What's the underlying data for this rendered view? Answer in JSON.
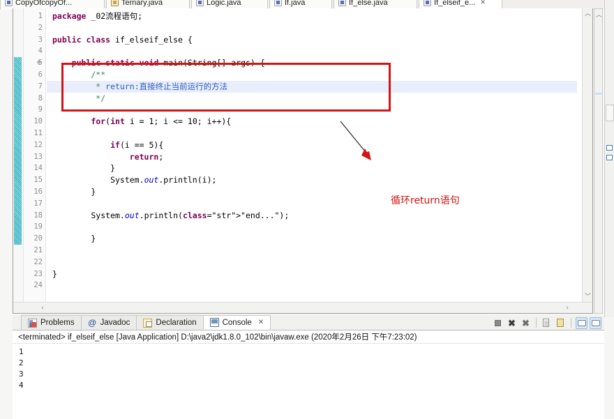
{
  "editor_tabs": [
    {
      "label": "CopyOfcopyOf...",
      "icon": "java-file-icon",
      "active": false,
      "closable": false,
      "modified": false
    },
    {
      "label": "Ternary.java",
      "icon": "java-file-modified-icon",
      "active": false,
      "closable": false,
      "modified": true
    },
    {
      "label": "Logic.java",
      "icon": "java-file-icon",
      "active": false,
      "closable": false,
      "modified": false
    },
    {
      "label": "If.java",
      "icon": "java-file-icon",
      "active": false,
      "closable": false,
      "modified": false
    },
    {
      "label": "If_else.java",
      "icon": "java-file-icon",
      "active": false,
      "closable": false,
      "modified": false
    },
    {
      "label": "If_elseif_e...",
      "icon": "java-file-icon",
      "active": true,
      "closable": true,
      "modified": false
    }
  ],
  "code": {
    "line_numbers": [
      1,
      2,
      3,
      4,
      5,
      6,
      7,
      8,
      9,
      10,
      11,
      12,
      13,
      14,
      15,
      16,
      17,
      18,
      19,
      20,
      21,
      22,
      23,
      24
    ],
    "highlighted_line": 7,
    "fold_marker_line": 5,
    "scope_bar_from": 5,
    "scope_bar_to": 20,
    "lines": [
      {
        "n": 1,
        "text": "package _02流程语句;"
      },
      {
        "n": 2,
        "text": ""
      },
      {
        "n": 3,
        "text": "public class if_elseif_else {"
      },
      {
        "n": 4,
        "text": ""
      },
      {
        "n": 5,
        "text": "    public static void main(String[] args) {"
      },
      {
        "n": 6,
        "text": "        /**"
      },
      {
        "n": 7,
        "text": "         * return:直接终止当前运行的方法"
      },
      {
        "n": 8,
        "text": "         */"
      },
      {
        "n": 9,
        "text": ""
      },
      {
        "n": 10,
        "text": "        for(int i = 1; i <= 10; i++){"
      },
      {
        "n": 11,
        "text": ""
      },
      {
        "n": 12,
        "text": "            if(i == 5){"
      },
      {
        "n": 13,
        "text": "                return;"
      },
      {
        "n": 14,
        "text": "            }"
      },
      {
        "n": 15,
        "text": "            System.out.println(i);"
      },
      {
        "n": 16,
        "text": "        }"
      },
      {
        "n": 17,
        "text": ""
      },
      {
        "n": 18,
        "text": "        System.out.println(\"end...\");"
      },
      {
        "n": 19,
        "text": ""
      },
      {
        "n": 20,
        "text": "        }"
      },
      {
        "n": 21,
        "text": ""
      },
      {
        "n": 22,
        "text": ""
      },
      {
        "n": 23,
        "text": "}"
      },
      {
        "n": 24,
        "text": ""
      }
    ]
  },
  "annotations": {
    "rect_label": "highlight-box-around-javadoc-comment",
    "callout_text": "循环return语句",
    "arrow_label": "red-arrow-pointing-to-for-loop",
    "color": "#d41414"
  },
  "bottom_panel": {
    "tabs": [
      {
        "label": "Problems",
        "icon": "problems-icon",
        "active": false,
        "closable": false
      },
      {
        "label": "Javadoc",
        "icon": "javadoc-icon",
        "active": false,
        "closable": false
      },
      {
        "label": "Declaration",
        "icon": "declaration-icon",
        "active": false,
        "closable": false
      },
      {
        "label": "Console",
        "icon": "console-icon",
        "active": true,
        "closable": true
      }
    ],
    "close_glyph": "✕",
    "toolbar": [
      {
        "name": "terminate-button",
        "icon": "stop-square-icon"
      },
      {
        "name": "remove-launch-button",
        "icon": "x-icon"
      },
      {
        "name": "remove-all-launches-button",
        "icon": "xx-icon"
      },
      {
        "name": "clear-console-button",
        "icon": "clear-page-icon"
      },
      {
        "name": "scroll-lock-button",
        "icon": "lock-icon"
      },
      {
        "name": "pin-console-button",
        "icon": "speech-bubble-icon"
      },
      {
        "name": "display-console-button",
        "icon": "speech-bubble-alt-icon"
      }
    ],
    "launch_status": "<terminated> if_elseif_else [Java Application] D:\\java2\\jdk1.8.0_102\\bin\\javaw.exe (2020年2月26日 下午7:23:02)",
    "output_lines": [
      "1",
      "2",
      "3",
      "4"
    ]
  },
  "scrollbars": {
    "v_up": "︿",
    "v_down": "﹀",
    "h_left": "‹",
    "h_right": "›"
  },
  "colors": {
    "keyword": "#7f0055",
    "comment": "#3f7f5f",
    "string": "#2a00ff",
    "field": "#0000c0",
    "annotation_red": "#d41414",
    "selection": "#e8eefb"
  }
}
